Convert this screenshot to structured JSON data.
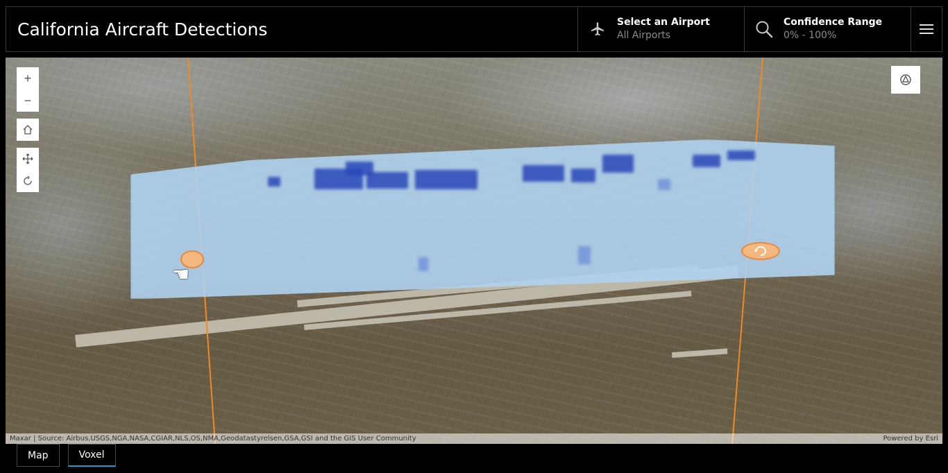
{
  "header": {
    "title": "California Aircraft Detections",
    "airport": {
      "label": "Select an Airport",
      "value": "All Airports",
      "icon": "airplane-icon"
    },
    "confidence": {
      "label": "Confidence Range",
      "value": "0% - 100%",
      "icon": "search-icon"
    },
    "menu_icon": "hamburger-menu-icon"
  },
  "map": {
    "controls": [
      {
        "name": "zoom-in-button",
        "glyph": "+"
      },
      {
        "name": "zoom-out-button",
        "glyph": "−"
      },
      {
        "name": "home-button",
        "icon": "home-icon"
      },
      {
        "name": "pan-button",
        "icon": "pan-icon"
      },
      {
        "name": "rotate-button",
        "icon": "rotate-icon"
      }
    ],
    "compass_icon": "compass-icon",
    "attribution_left": "Maxar | Source: Airbus,USGS,NGA,NASA,CGIAR,NLS,OS,NMA,Geodatastyrelsen,GSA,GSI and the GIS User Community",
    "attribution_right": "Powered by Esri"
  },
  "tabs": [
    {
      "label": "Map",
      "active": false
    },
    {
      "label": "Voxel",
      "active": true
    }
  ],
  "colors": {
    "accent": "#1a9cd8",
    "slice": "#f08a24",
    "voxel": "#afd2f0",
    "detection": "#2a49b8"
  }
}
